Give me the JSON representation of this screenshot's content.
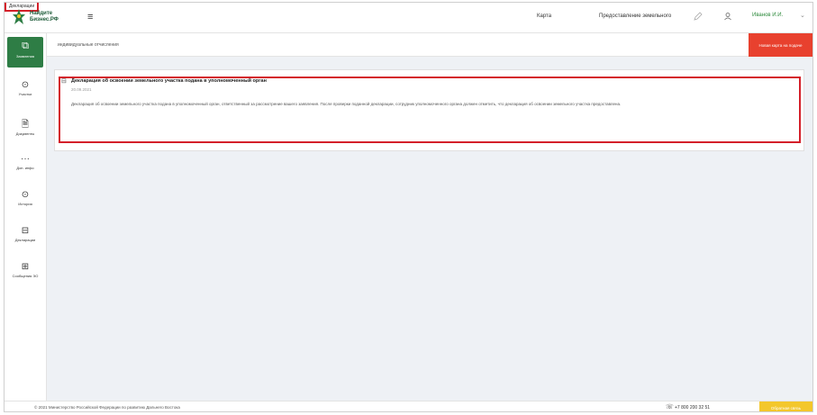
{
  "header": {
    "logo_line1": "Найдите",
    "logo_line2": "Бизнес.РФ",
    "menu_icon": "≡",
    "nav_maps": "Карта",
    "nav_declarations": "Декларации",
    "nav_plots": "Предоставление земельного",
    "edit_icon": "edit-icon",
    "user_icon": "user-icon",
    "user_name": "Иванов И.И.",
    "chevron": "⌄"
  },
  "sidebar": {
    "items": [
      {
        "icon": "⧉",
        "label": "Заявления"
      },
      {
        "icon": "⊙",
        "label": "Участки"
      },
      {
        "icon": "🗎",
        "label": "Документы"
      },
      {
        "icon": "···",
        "label": "Доп. инфо"
      },
      {
        "icon": "⊙",
        "label": "История"
      },
      {
        "icon": "⊟",
        "label": "Декларации"
      },
      {
        "icon": "⊞",
        "label": "Сообщения ЭО"
      }
    ]
  },
  "subheader": {
    "breadcrumb": "индивидуальные отчисления",
    "red_button": "Новая карта на подаче"
  },
  "card": {
    "icon": "⊟",
    "title": "Декларация об освоении земельного участка подана в уполномоченный орган",
    "date": "20.09.2021",
    "body": "Декларация об освоении земельного участка подана в уполномоченный орган, ответственный за рассмотрение вашего заявления. После проверки поданной декларации, сотрудник уполномоченного органа должен отметить, что декларация об освоении земельного участка предоставлена."
  },
  "footer": {
    "copyright": "© 2021 Министерство Российской Федерации по развитию Дальнего Востока",
    "phone_icon": "☏",
    "phone": "+7 800 200 32 51",
    "yellow_button": "Обратная связь"
  },
  "colors": {
    "brand_green": "#2e7d45",
    "accent_red": "#e8412e",
    "highlight_red": "#d4202a",
    "accent_yellow": "#f3c72c"
  }
}
